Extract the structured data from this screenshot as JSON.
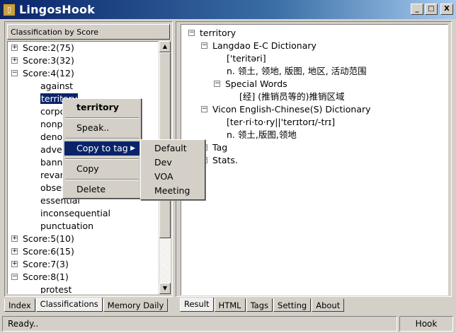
{
  "window": {
    "title": "LingosHook",
    "minimize": "_",
    "maximize": "□",
    "close": "X"
  },
  "left_panel": {
    "classification_header": "Classification by Score",
    "tree": [
      {
        "label": "Score:2(75)",
        "expander": "+"
      },
      {
        "label": "Score:3(32)",
        "expander": "+"
      },
      {
        "label": "Score:4(12)",
        "expander": "−"
      },
      {
        "label": "against"
      },
      {
        "label": "territory"
      },
      {
        "label": "corpo"
      },
      {
        "label": "nonpr"
      },
      {
        "label": "denou"
      },
      {
        "label": "adver"
      },
      {
        "label": "banne"
      },
      {
        "label": "revam"
      },
      {
        "label": "obses"
      },
      {
        "label": "essential"
      },
      {
        "label": "inconsequential"
      },
      {
        "label": "punctuation"
      },
      {
        "label": "Score:5(10)",
        "expander": "+"
      },
      {
        "label": "Score:6(15)",
        "expander": "+"
      },
      {
        "label": "Score:7(3)",
        "expander": "+"
      },
      {
        "label": "Score:8(1)",
        "expander": "−"
      },
      {
        "label": "protest"
      }
    ],
    "tabs": [
      "Index",
      "Classifications",
      "Memory Daily"
    ],
    "active_tab": "Classifications"
  },
  "context_menu": {
    "header": "territory",
    "items": [
      "Speak..",
      "Copy to tag",
      "Copy",
      "Delete"
    ],
    "highlighted": "Copy to tag",
    "submenu": [
      "Default",
      "Dev",
      "VOA",
      "Meeting"
    ]
  },
  "right_panel": {
    "tree": [
      {
        "label": "territory",
        "expander": "−"
      },
      {
        "label": "Langdao E-C Dictionary",
        "expander": "−"
      },
      {
        "label": "['teritəri]"
      },
      {
        "label": "n. 领土, 领地, 版图, 地区, 活动范围"
      },
      {
        "label": "Special Words",
        "expander": "−"
      },
      {
        "label": "[经] (推销员等的)推销区域"
      },
      {
        "label": "Vicon English-Chinese(S) Dictionary",
        "expander": "−"
      },
      {
        "label": "[ter·ri·to·ry||'terɪtorɪ/-trɪ]"
      },
      {
        "label": "n. 领土,版图,领地"
      },
      {
        "label": "Tag",
        "expander": "+"
      },
      {
        "label": "Stats.",
        "expander": "+"
      }
    ],
    "tabs": [
      "Result",
      "HTML",
      "Tags",
      "Setting",
      "About"
    ],
    "active_tab": "Result"
  },
  "status": {
    "text": "Ready..",
    "hook": "Hook"
  },
  "colors": {
    "title_bar": "#0a246a",
    "selection": "#0a246a",
    "chrome": "#d4d0c8"
  }
}
